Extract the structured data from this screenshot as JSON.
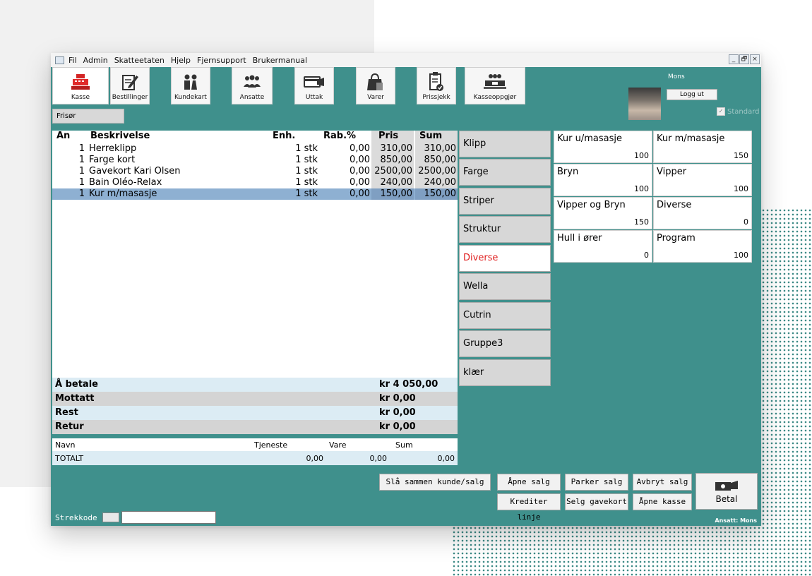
{
  "menu": [
    "Fil",
    "Admin",
    "Skatteetaten",
    "Hjelp",
    "Fjernsupport",
    "Brukermanual"
  ],
  "window_controls": [
    "_",
    "🗗",
    "×"
  ],
  "toolbar": {
    "items": [
      {
        "label": "Kasse",
        "icon": "cash-register-icon"
      },
      {
        "label": "Bestillinger",
        "icon": "edit-icon"
      },
      {
        "label": "Kundekart",
        "icon": "couple-icon"
      },
      {
        "label": "Ansatte",
        "icon": "group-icon"
      },
      {
        "label": "Uttak",
        "icon": "card-icon"
      },
      {
        "label": "Varer",
        "icon": "shopping-bag-icon"
      },
      {
        "label": "Prissjekk",
        "icon": "clipboard-check-icon"
      },
      {
        "label": "Kasseoppgjør",
        "icon": "cash-stack-icon"
      }
    ]
  },
  "user": {
    "name": "Mons",
    "logout_label": "Logg ut"
  },
  "group_tab": "Frisør",
  "standard_checkbox": {
    "label": "Standard",
    "checked": true
  },
  "order": {
    "headers": {
      "qty": "An",
      "desc": "Beskrivelse",
      "unit": "Enh.",
      "discount": "Rab.%",
      "price": "Pris",
      "sum": "Sum"
    },
    "rows": [
      {
        "qty": "1",
        "desc": "Herreklipp",
        "unit": "1 stk",
        "discount": "0,00",
        "price": "310,00",
        "sum": "310,00"
      },
      {
        "qty": "1",
        "desc": "Farge kort",
        "unit": "1 stk",
        "discount": "0,00",
        "price": "850,00",
        "sum": "850,00"
      },
      {
        "qty": "1",
        "desc": "Gavekort Kari Olsen",
        "unit": "1 stk",
        "discount": "0,00",
        "price": "2500,00",
        "sum": "2500,00"
      },
      {
        "qty": "1",
        "desc": "Bain Oléo-Relax",
        "unit": "1 stk",
        "discount": "0,00",
        "price": "240,00",
        "sum": "240,00"
      },
      {
        "qty": "1",
        "desc": "Kur m/masasje",
        "unit": "1 stk",
        "discount": "0,00",
        "price": "150,00",
        "sum": "150,00"
      }
    ]
  },
  "totals": [
    {
      "label": "Å betale",
      "value": "kr 4 050,00"
    },
    {
      "label": "Mottatt",
      "value": "kr 0,00"
    },
    {
      "label": "Rest",
      "value": "kr 0,00"
    },
    {
      "label": "Retur",
      "value": "kr 0,00"
    }
  ],
  "employee_table": {
    "headers": {
      "name": "Navn",
      "service": "Tjeneste",
      "goods": "Vare",
      "sum": "Sum"
    },
    "total_row": {
      "name": "TOTALT",
      "service": "0,00",
      "goods": "0,00",
      "sum": "0,00"
    }
  },
  "categories": [
    "Klipp",
    "Farge",
    "Striper",
    "Struktur",
    "Diverse",
    "Wella",
    "Cutrin",
    "Gruppe3",
    "klær"
  ],
  "active_category": "Diverse",
  "products": [
    {
      "name": "Kur u/masasje",
      "price": "100"
    },
    {
      "name": "Kur m/masasje",
      "price": "150"
    },
    {
      "name": "Bryn",
      "price": "100"
    },
    {
      "name": "Vipper",
      "price": "100"
    },
    {
      "name": "Vipper og Bryn",
      "price": "150"
    },
    {
      "name": "Diverse",
      "price": "0"
    },
    {
      "name": "Hull i ører",
      "price": "0"
    },
    {
      "name": "Program",
      "price": "100"
    }
  ],
  "buttons": {
    "merge": "Slå sammen kunde/salg",
    "open_sale": "Åpne salg",
    "park": "Parker salg",
    "cancel": "Avbryt salg",
    "credit_line": "Krediter linje",
    "gift_card": "Selg gavekort",
    "open_drawer": "Åpne kasse",
    "pay": "Betal"
  },
  "barcode": {
    "label": "Strekkode",
    "value": ""
  },
  "status": "Ansatt: Mons",
  "colors": {
    "teal": "#3f908c",
    "selected_row": "#8eb0d2",
    "active_category_text": "#e02020"
  }
}
